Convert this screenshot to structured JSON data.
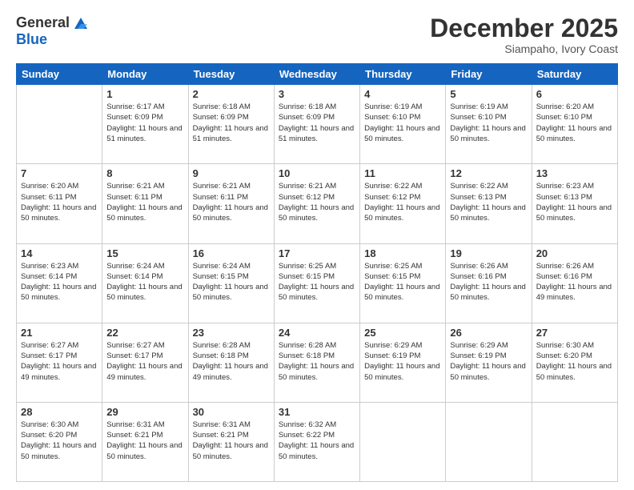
{
  "logo": {
    "general": "General",
    "blue": "Blue"
  },
  "header": {
    "month": "December 2025",
    "location": "Siampaho, Ivory Coast"
  },
  "weekdays": [
    "Sunday",
    "Monday",
    "Tuesday",
    "Wednesday",
    "Thursday",
    "Friday",
    "Saturday"
  ],
  "weeks": [
    [
      {
        "day": "",
        "sunrise": "",
        "sunset": "",
        "daylight": ""
      },
      {
        "day": "1",
        "sunrise": "Sunrise: 6:17 AM",
        "sunset": "Sunset: 6:09 PM",
        "daylight": "Daylight: 11 hours and 51 minutes."
      },
      {
        "day": "2",
        "sunrise": "Sunrise: 6:18 AM",
        "sunset": "Sunset: 6:09 PM",
        "daylight": "Daylight: 11 hours and 51 minutes."
      },
      {
        "day": "3",
        "sunrise": "Sunrise: 6:18 AM",
        "sunset": "Sunset: 6:09 PM",
        "daylight": "Daylight: 11 hours and 51 minutes."
      },
      {
        "day": "4",
        "sunrise": "Sunrise: 6:19 AM",
        "sunset": "Sunset: 6:10 PM",
        "daylight": "Daylight: 11 hours and 50 minutes."
      },
      {
        "day": "5",
        "sunrise": "Sunrise: 6:19 AM",
        "sunset": "Sunset: 6:10 PM",
        "daylight": "Daylight: 11 hours and 50 minutes."
      },
      {
        "day": "6",
        "sunrise": "Sunrise: 6:20 AM",
        "sunset": "Sunset: 6:10 PM",
        "daylight": "Daylight: 11 hours and 50 minutes."
      }
    ],
    [
      {
        "day": "7",
        "sunrise": "Sunrise: 6:20 AM",
        "sunset": "Sunset: 6:11 PM",
        "daylight": "Daylight: 11 hours and 50 minutes."
      },
      {
        "day": "8",
        "sunrise": "Sunrise: 6:21 AM",
        "sunset": "Sunset: 6:11 PM",
        "daylight": "Daylight: 11 hours and 50 minutes."
      },
      {
        "day": "9",
        "sunrise": "Sunrise: 6:21 AM",
        "sunset": "Sunset: 6:11 PM",
        "daylight": "Daylight: 11 hours and 50 minutes."
      },
      {
        "day": "10",
        "sunrise": "Sunrise: 6:21 AM",
        "sunset": "Sunset: 6:12 PM",
        "daylight": "Daylight: 11 hours and 50 minutes."
      },
      {
        "day": "11",
        "sunrise": "Sunrise: 6:22 AM",
        "sunset": "Sunset: 6:12 PM",
        "daylight": "Daylight: 11 hours and 50 minutes."
      },
      {
        "day": "12",
        "sunrise": "Sunrise: 6:22 AM",
        "sunset": "Sunset: 6:13 PM",
        "daylight": "Daylight: 11 hours and 50 minutes."
      },
      {
        "day": "13",
        "sunrise": "Sunrise: 6:23 AM",
        "sunset": "Sunset: 6:13 PM",
        "daylight": "Daylight: 11 hours and 50 minutes."
      }
    ],
    [
      {
        "day": "14",
        "sunrise": "Sunrise: 6:23 AM",
        "sunset": "Sunset: 6:14 PM",
        "daylight": "Daylight: 11 hours and 50 minutes."
      },
      {
        "day": "15",
        "sunrise": "Sunrise: 6:24 AM",
        "sunset": "Sunset: 6:14 PM",
        "daylight": "Daylight: 11 hours and 50 minutes."
      },
      {
        "day": "16",
        "sunrise": "Sunrise: 6:24 AM",
        "sunset": "Sunset: 6:15 PM",
        "daylight": "Daylight: 11 hours and 50 minutes."
      },
      {
        "day": "17",
        "sunrise": "Sunrise: 6:25 AM",
        "sunset": "Sunset: 6:15 PM",
        "daylight": "Daylight: 11 hours and 50 minutes."
      },
      {
        "day": "18",
        "sunrise": "Sunrise: 6:25 AM",
        "sunset": "Sunset: 6:15 PM",
        "daylight": "Daylight: 11 hours and 50 minutes."
      },
      {
        "day": "19",
        "sunrise": "Sunrise: 6:26 AM",
        "sunset": "Sunset: 6:16 PM",
        "daylight": "Daylight: 11 hours and 50 minutes."
      },
      {
        "day": "20",
        "sunrise": "Sunrise: 6:26 AM",
        "sunset": "Sunset: 6:16 PM",
        "daylight": "Daylight: 11 hours and 49 minutes."
      }
    ],
    [
      {
        "day": "21",
        "sunrise": "Sunrise: 6:27 AM",
        "sunset": "Sunset: 6:17 PM",
        "daylight": "Daylight: 11 hours and 49 minutes."
      },
      {
        "day": "22",
        "sunrise": "Sunrise: 6:27 AM",
        "sunset": "Sunset: 6:17 PM",
        "daylight": "Daylight: 11 hours and 49 minutes."
      },
      {
        "day": "23",
        "sunrise": "Sunrise: 6:28 AM",
        "sunset": "Sunset: 6:18 PM",
        "daylight": "Daylight: 11 hours and 49 minutes."
      },
      {
        "day": "24",
        "sunrise": "Sunrise: 6:28 AM",
        "sunset": "Sunset: 6:18 PM",
        "daylight": "Daylight: 11 hours and 50 minutes."
      },
      {
        "day": "25",
        "sunrise": "Sunrise: 6:29 AM",
        "sunset": "Sunset: 6:19 PM",
        "daylight": "Daylight: 11 hours and 50 minutes."
      },
      {
        "day": "26",
        "sunrise": "Sunrise: 6:29 AM",
        "sunset": "Sunset: 6:19 PM",
        "daylight": "Daylight: 11 hours and 50 minutes."
      },
      {
        "day": "27",
        "sunrise": "Sunrise: 6:30 AM",
        "sunset": "Sunset: 6:20 PM",
        "daylight": "Daylight: 11 hours and 50 minutes."
      }
    ],
    [
      {
        "day": "28",
        "sunrise": "Sunrise: 6:30 AM",
        "sunset": "Sunset: 6:20 PM",
        "daylight": "Daylight: 11 hours and 50 minutes."
      },
      {
        "day": "29",
        "sunrise": "Sunrise: 6:31 AM",
        "sunset": "Sunset: 6:21 PM",
        "daylight": "Daylight: 11 hours and 50 minutes."
      },
      {
        "day": "30",
        "sunrise": "Sunrise: 6:31 AM",
        "sunset": "Sunset: 6:21 PM",
        "daylight": "Daylight: 11 hours and 50 minutes."
      },
      {
        "day": "31",
        "sunrise": "Sunrise: 6:32 AM",
        "sunset": "Sunset: 6:22 PM",
        "daylight": "Daylight: 11 hours and 50 minutes."
      },
      {
        "day": "",
        "sunrise": "",
        "sunset": "",
        "daylight": ""
      },
      {
        "day": "",
        "sunrise": "",
        "sunset": "",
        "daylight": ""
      },
      {
        "day": "",
        "sunrise": "",
        "sunset": "",
        "daylight": ""
      }
    ]
  ]
}
